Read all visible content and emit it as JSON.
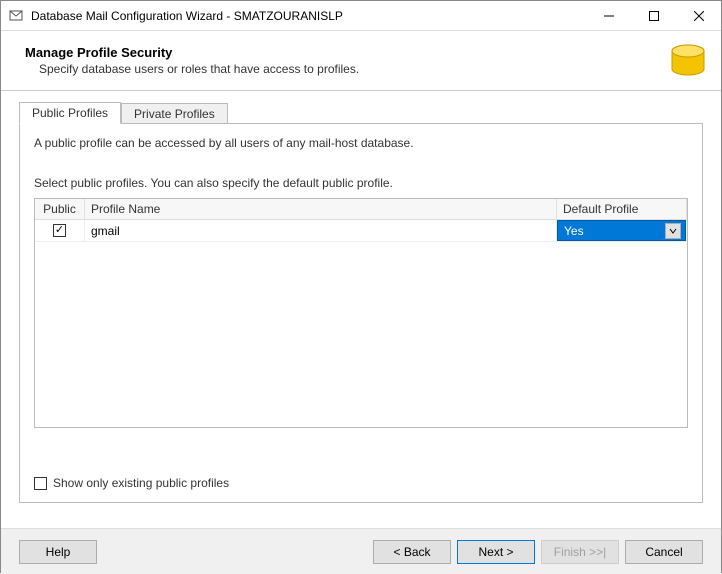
{
  "window": {
    "title": "Database Mail Configuration Wizard - SMATZOURANISLP"
  },
  "header": {
    "title": "Manage Profile Security",
    "subtitle": "Specify database users or roles that have access to profiles."
  },
  "tabs": {
    "public": "Public Profiles",
    "private": "Private Profiles"
  },
  "panel": {
    "info": "A public profile can be accessed by all users of any mail-host database.",
    "instruction": "Select public profiles. You can also specify the default public profile.",
    "columns": {
      "public": "Public",
      "name": "Profile Name",
      "default": "Default Profile"
    },
    "rows": [
      {
        "public_checked": true,
        "name": "gmail",
        "default_value": "Yes"
      }
    ],
    "show_only_label": "Show only existing public profiles",
    "show_only_checked": false
  },
  "footer": {
    "help": "Help",
    "back": "< Back",
    "next": "Next >",
    "finish": "Finish >>|",
    "cancel": "Cancel"
  }
}
